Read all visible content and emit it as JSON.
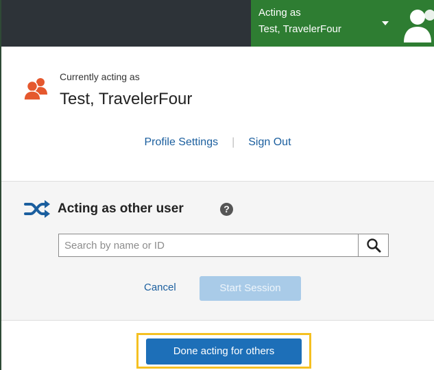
{
  "header": {
    "acting_label": "Acting as",
    "acting_name": "Test, TravelerFour"
  },
  "current_user": {
    "label": "Currently acting as",
    "name": "Test, TravelerFour"
  },
  "links": {
    "profile_settings": "Profile Settings",
    "separator": "|",
    "sign_out": "Sign Out"
  },
  "act_as_other": {
    "heading": "Acting as other user",
    "help": "?",
    "search_placeholder": "Search by name or ID",
    "search_value": "",
    "cancel_label": "Cancel",
    "start_label": "Start Session"
  },
  "done_button": {
    "label": "Done acting for others"
  },
  "colors": {
    "banner_green": "#2e7d32",
    "header_dark": "#2d3338",
    "link_blue": "#1a5e9e",
    "button_blue": "#1d6fb8",
    "disabled_blue": "#a9cbe8",
    "highlight_yellow": "#f5c021",
    "user_icon_orange": "#e5582e"
  },
  "icons": {
    "banner_avatar": "user-icon",
    "current_user": "users-icon",
    "act_as_other": "shuffle-icon",
    "help": "question-circle-icon",
    "search": "search-icon",
    "banner_dropdown": "caret-down-icon"
  }
}
